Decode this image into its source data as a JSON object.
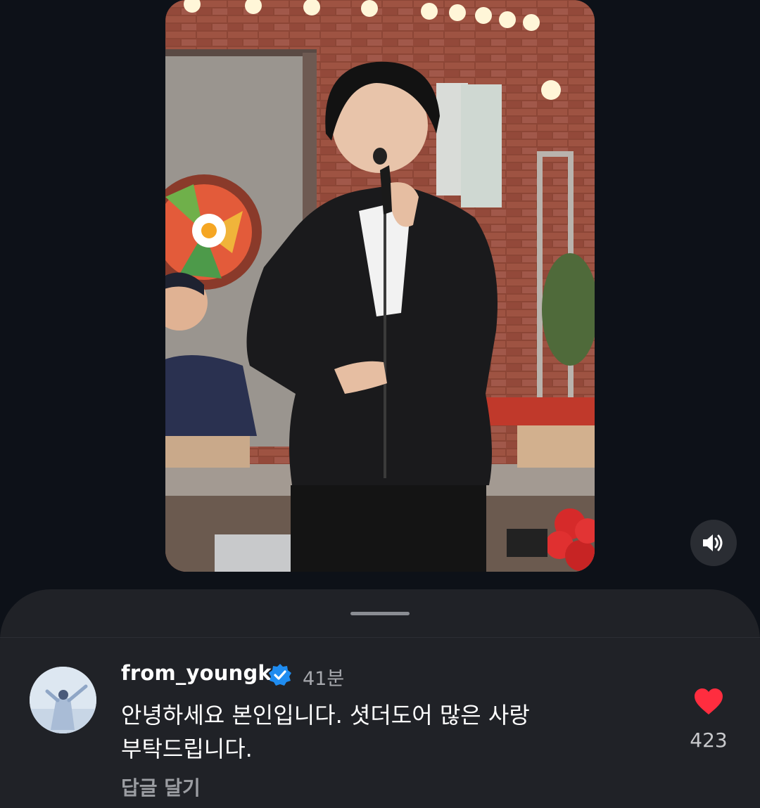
{
  "comment": {
    "username": "from_youngk",
    "verified": true,
    "time": "41분",
    "text_line1": "안녕하세요 본인입니다. 셧더도어 많은 사랑",
    "text_line2": "부탁드립니다.",
    "reply_label": "답글 달기",
    "like_count": "423"
  },
  "icons": {
    "sound": "speaker-on-icon",
    "like": "heart-filled-icon",
    "verified": "verified-badge-icon"
  },
  "colors": {
    "background": "#0d1118",
    "sheet": "#202227",
    "heart": "#ff2d3f",
    "verified": "#1f8cf0"
  }
}
